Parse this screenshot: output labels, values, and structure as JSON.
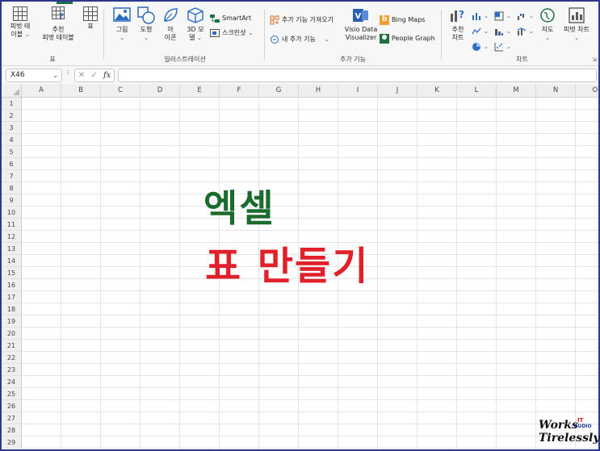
{
  "ribbon": {
    "table_group": {
      "label": "표",
      "pivot_table": [
        "피벗 테",
        "이블"
      ],
      "recommended_pivot": [
        "추천",
        "피벗 테이블"
      ],
      "table": "표"
    },
    "illustrations_group": {
      "label": "일러스트레이션",
      "pictures": "그림",
      "shapes": "도형",
      "icons": [
        "아",
        "이콘"
      ],
      "models_3d": [
        "3D 모",
        "델"
      ],
      "smartart": "SmartArt",
      "screenshot": "스크린샷"
    },
    "addins_group": {
      "label": "추가 기능",
      "get_addins": "추가 기능 가져오기",
      "my_addins": "내 추가 기능",
      "visio": [
        "Visio Data",
        "Visualizer"
      ],
      "bing_maps": "Bing Maps",
      "people_graph": "People Graph"
    },
    "charts_group": {
      "label": "차트",
      "recommended_charts": [
        "추천",
        "차트"
      ],
      "maps": "지도",
      "pivot_chart": "피벗 차트"
    }
  },
  "formula_bar": {
    "name_box": "X46",
    "fx": "fx",
    "formula": ""
  },
  "grid": {
    "columns": [
      "A",
      "B",
      "C",
      "D",
      "E",
      "F",
      "G",
      "H",
      "I",
      "J",
      "K",
      "L",
      "M",
      "N",
      "O"
    ],
    "rows": [
      1,
      2,
      3,
      4,
      5,
      6,
      7,
      8,
      9,
      10,
      11,
      12,
      13,
      14,
      15,
      16,
      17,
      18,
      19,
      20,
      21,
      22,
      23,
      24,
      25,
      26,
      27,
      28,
      29
    ]
  },
  "overlay": {
    "title_line1": "엑셀",
    "title_line2": "표 만들기",
    "line1_color": "#1a6b2c",
    "line2_color": "#e0202a"
  },
  "logo": {
    "line1": "Works",
    "line2": "Tirelessly",
    "badge_it": "IT",
    "badge_audio": "AUDIO"
  }
}
